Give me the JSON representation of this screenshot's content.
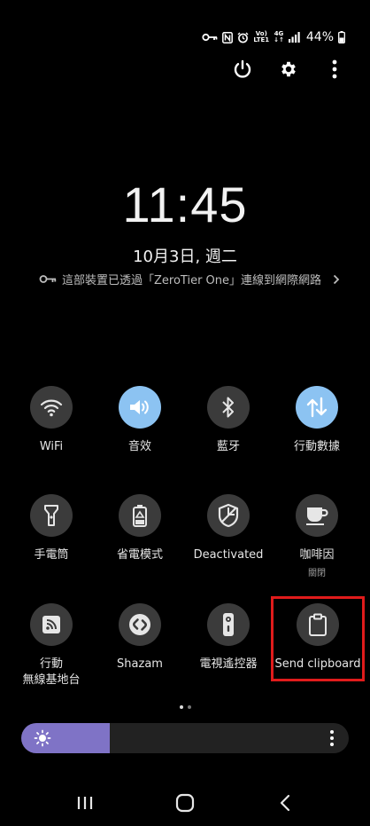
{
  "status": {
    "network_top": "Vo)",
    "network_bottom": "LTE1",
    "net_type_top": "4G",
    "net_type_bottom": "↓↑",
    "battery": "44%"
  },
  "clock": {
    "time": "11:45",
    "date": "10月3日, 週二"
  },
  "vpn": {
    "text": "這部裝置已透過「ZeroTier One」連線到網際網路"
  },
  "tiles": [
    {
      "label": "WiFi",
      "icon": "wifi-icon",
      "active": false
    },
    {
      "label": "音效",
      "icon": "volume-icon",
      "active": true
    },
    {
      "label": "藍牙",
      "icon": "bluetooth-icon",
      "active": false
    },
    {
      "label": "行動數據",
      "icon": "mobile-data-icon",
      "active": true
    },
    {
      "label": "手電筒",
      "icon": "flashlight-icon",
      "active": false
    },
    {
      "label": "省電模式",
      "icon": "battery-saver-icon",
      "active": false
    },
    {
      "label": "Deactivated",
      "icon": "shield-icon",
      "active": false
    },
    {
      "label": "咖啡因",
      "sublabel": "關閉",
      "icon": "coffee-icon",
      "active": false
    },
    {
      "label": "行動",
      "sublabel": "無線基地台",
      "icon": "hotspot-icon",
      "active": false
    },
    {
      "label": "Shazam",
      "icon": "shazam-icon",
      "active": false
    },
    {
      "label": "電視遙控器",
      "icon": "remote-icon",
      "active": false
    },
    {
      "label": "Send clipboard",
      "icon": "clipboard-icon",
      "active": false
    }
  ],
  "brightness": {
    "level": 0.27
  },
  "colors": {
    "accent": "#8cc3f2",
    "brightness": "#7f73c6",
    "highlight": "#e01b1b",
    "tile_bg": "#3b3b3b"
  }
}
